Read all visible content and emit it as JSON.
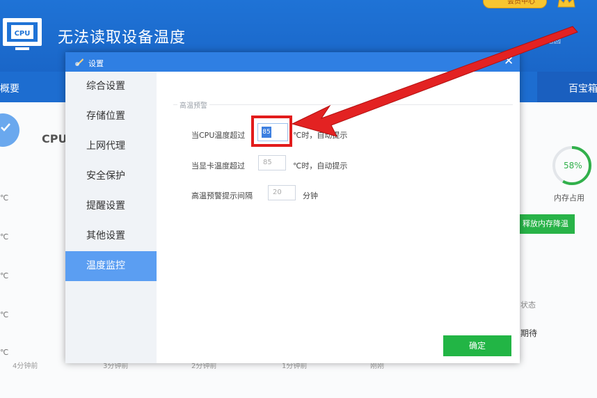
{
  "app": {
    "title": "无法读取设备温度",
    "cpu_icon_text": "CPU",
    "vip_text": "会员中心",
    "top_right_text": "返回",
    "nav_left": "概要",
    "nav_right": "百宝箱",
    "cpu_label": "CPU",
    "temp_unit_labels": [
      "℃",
      "℃",
      "℃",
      "℃",
      "℃"
    ],
    "time_labels": [
      "4分钟前",
      "3分钟前",
      "2分钟前",
      "1分钟前",
      "刚刚"
    ],
    "memory_percent": "58%",
    "memory_label": "内存占用",
    "release_button": "释放内存降温",
    "side_texts": [
      "状态",
      "期待"
    ]
  },
  "dialog": {
    "title": "设置",
    "close_glyph": "✕",
    "sidebar": [
      {
        "label": "综合设置",
        "active": false
      },
      {
        "label": "存储位置",
        "active": false
      },
      {
        "label": "上网代理",
        "active": false
      },
      {
        "label": "安全保护",
        "active": false
      },
      {
        "label": "提醒设置",
        "active": false
      },
      {
        "label": "其他设置",
        "active": false
      },
      {
        "label": "温度监控",
        "active": true
      }
    ],
    "group_label": "高温预警",
    "cpu_row": {
      "label": "当CPU温度超过",
      "value": "85",
      "suffix": "℃时，自动提示"
    },
    "gpu_row": {
      "label": "当显卡温度超过",
      "value": "85",
      "suffix": "℃时，自动提示"
    },
    "interval_row": {
      "label": "高温预警提示间隔",
      "value": "20",
      "suffix": "分钟"
    },
    "ok_button": "确定"
  },
  "colors": {
    "header_blue": "#1f73d6",
    "dialog_title_blue": "#2f7fe3",
    "active_item": "#5b9ef2",
    "ok_green": "#22b545",
    "highlight_red": "#e21c1c"
  },
  "icons": [
    "cpu-icon",
    "crown-icon",
    "check-icon",
    "gear-icon",
    "close-icon",
    "arrow-annotation"
  ]
}
